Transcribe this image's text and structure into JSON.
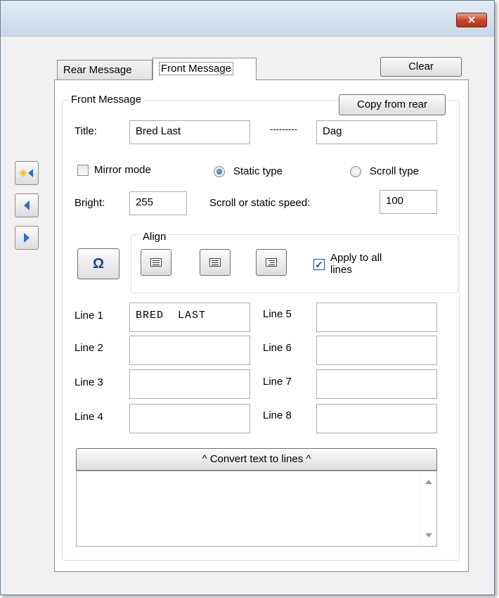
{
  "window": {
    "close_glyph": "✕"
  },
  "sidebar": {
    "buttons": [
      {
        "icon": "copy-message-icon"
      },
      {
        "icon": "arrow-left-icon"
      },
      {
        "icon": "arrow-right-icon"
      }
    ]
  },
  "tabs": [
    {
      "label": "Rear Message",
      "active": false
    },
    {
      "label": "Front Message",
      "active": true
    }
  ],
  "clear_label": "Clear",
  "front": {
    "group_title": "Front Message",
    "copy_from_rear_label": "Copy from rear",
    "title_label": "Title:",
    "title_value": "Bred Last",
    "separator": "---------",
    "title_second_value": "Dag",
    "mirror_mode_label": "Mirror mode",
    "mirror_mode_checked": false,
    "static_type_label": "Static type",
    "static_type_selected": true,
    "scroll_type_label": "Scroll type",
    "bright_label": "Bright:",
    "bright_value": "255",
    "speed_label": "Scroll or static speed:",
    "speed_value": "100",
    "omega_glyph": "Ω",
    "align": {
      "group_title": "Align",
      "apply_all_label_1": "Apply to all",
      "apply_all_label_2": "lines",
      "apply_all_checked": true,
      "check_glyph": "✓"
    },
    "lines": [
      {
        "label": "Line 1",
        "value": "BRED  LAST"
      },
      {
        "label": "Line 2",
        "value": ""
      },
      {
        "label": "Line 3",
        "value": ""
      },
      {
        "label": "Line 4",
        "value": ""
      },
      {
        "label": "Line 5",
        "value": ""
      },
      {
        "label": "Line 6",
        "value": ""
      },
      {
        "label": "Line 7",
        "value": ""
      },
      {
        "label": "Line 8",
        "value": ""
      }
    ],
    "convert_label": "^ Convert text to lines ^",
    "text_area_value": ""
  },
  "colors": {
    "accent": "#18579e",
    "close": "#c7432a",
    "titlebar": "#c9d7e7"
  }
}
